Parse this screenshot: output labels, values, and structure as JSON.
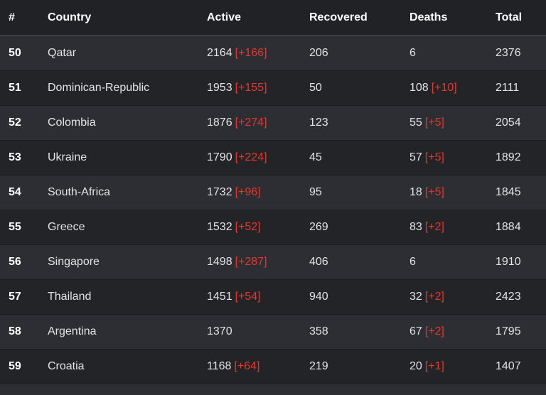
{
  "table": {
    "headers": [
      "#",
      "Country",
      "Active",
      "Recovered",
      "Deaths",
      "Total"
    ],
    "rows": [
      {
        "rank": "50",
        "country": "Qatar",
        "active": "2164",
        "active_delta": "[+166]",
        "recovered": "206",
        "deaths": "6",
        "deaths_delta": "",
        "total": "2376"
      },
      {
        "rank": "51",
        "country": "Dominican-Republic",
        "active": "1953",
        "active_delta": "[+155]",
        "recovered": "50",
        "deaths": "108",
        "deaths_delta": "[+10]",
        "total": "2111"
      },
      {
        "rank": "52",
        "country": "Colombia",
        "active": "1876",
        "active_delta": "[+274]",
        "recovered": "123",
        "deaths": "55",
        "deaths_delta": "[+5]",
        "total": "2054"
      },
      {
        "rank": "53",
        "country": "Ukraine",
        "active": "1790",
        "active_delta": "[+224]",
        "recovered": "45",
        "deaths": "57",
        "deaths_delta": "[+5]",
        "total": "1892"
      },
      {
        "rank": "54",
        "country": "South-Africa",
        "active": "1732",
        "active_delta": "[+96]",
        "recovered": "95",
        "deaths": "18",
        "deaths_delta": "[+5]",
        "total": "1845"
      },
      {
        "rank": "55",
        "country": "Greece",
        "active": "1532",
        "active_delta": "[+52]",
        "recovered": "269",
        "deaths": "83",
        "deaths_delta": "[+2]",
        "total": "1884"
      },
      {
        "rank": "56",
        "country": "Singapore",
        "active": "1498",
        "active_delta": "[+287]",
        "recovered": "406",
        "deaths": "6",
        "deaths_delta": "",
        "total": "1910"
      },
      {
        "rank": "57",
        "country": "Thailand",
        "active": "1451",
        "active_delta": "[+54]",
        "recovered": "940",
        "deaths": "32",
        "deaths_delta": "[+2]",
        "total": "2423"
      },
      {
        "rank": "58",
        "country": "Argentina",
        "active": "1370",
        "active_delta": "",
        "recovered": "358",
        "deaths": "67",
        "deaths_delta": "[+2]",
        "total": "1795"
      },
      {
        "rank": "59",
        "country": "Croatia",
        "active": "1168",
        "active_delta": "[+64]",
        "recovered": "219",
        "deaths": "20",
        "deaths_delta": "[+1]",
        "total": "1407"
      }
    ]
  },
  "colors": {
    "background": "#2a2c30",
    "row_odd": "#2c2e33",
    "row_even": "#222428",
    "header": "#202226",
    "delta_red": "#e8362a",
    "text": "#e3e3e3"
  }
}
